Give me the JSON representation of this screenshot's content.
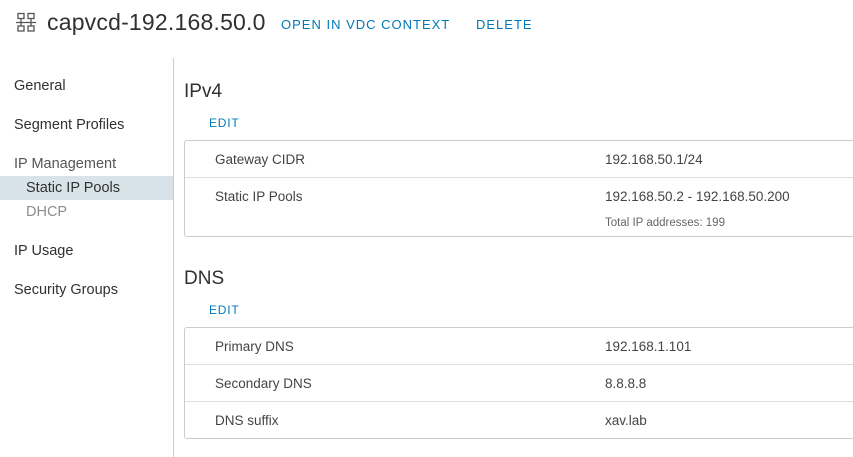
{
  "header": {
    "icon": "network-segment-icon",
    "title": "capvcd-192.168.50.0",
    "actions": [
      "OPEN IN VDC CONTEXT",
      "DELETE"
    ]
  },
  "sidebar": {
    "items": [
      {
        "label": "General"
      },
      {
        "label": "Segment Profiles"
      },
      {
        "label": "IP Management",
        "children": [
          {
            "label": "Static IP Pools",
            "active": true
          },
          {
            "label": "DHCP"
          }
        ]
      },
      {
        "label": "IP Usage"
      },
      {
        "label": "Security Groups"
      }
    ]
  },
  "ipv4": {
    "title": "IPv4",
    "edit_label": "EDIT",
    "rows": [
      {
        "key": "Gateway CIDR",
        "value": "192.168.50.1/24"
      },
      {
        "key": "Static IP Pools",
        "value": "192.168.50.2 - 192.168.50.200",
        "sub": "Total IP addresses: 199"
      }
    ]
  },
  "dns": {
    "title": "DNS",
    "edit_label": "EDIT",
    "rows": [
      {
        "key": "Primary DNS",
        "value": "192.168.1.101"
      },
      {
        "key": "Secondary DNS",
        "value": "8.8.8.8"
      },
      {
        "key": "DNS suffix",
        "value": "xav.lab"
      }
    ]
  },
  "colors": {
    "link": "#0079b8",
    "active_nav_bg": "#d8e3e9",
    "border": "#cccccc"
  }
}
